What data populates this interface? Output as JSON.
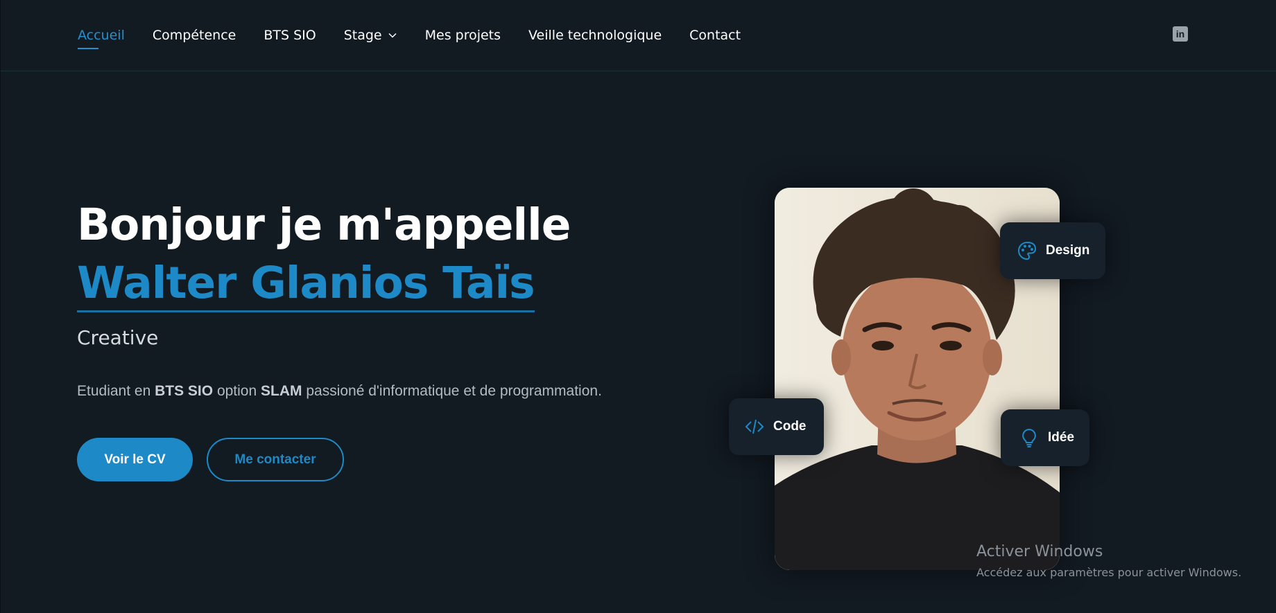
{
  "nav": {
    "items": [
      {
        "label": "Accueil",
        "active": true
      },
      {
        "label": "Compétence",
        "active": false
      },
      {
        "label": "BTS SIO",
        "active": false
      },
      {
        "label": "Stage",
        "active": false,
        "has_dropdown": true
      },
      {
        "label": "Mes projets",
        "active": false
      },
      {
        "label": "Veille technologique",
        "active": false
      },
      {
        "label": "Contact",
        "active": false
      }
    ],
    "social_icon": "linkedin-icon",
    "social_glyph": "in"
  },
  "hero": {
    "greeting": "Bonjour je m'appelle",
    "name": "Walter Glanios Taïs",
    "role": "Creative",
    "description": {
      "p1": "Etudiant en ",
      "b1": "BTS SIO",
      "p2": " option ",
      "b2": "SLAM",
      "p3": " passioné d'informatique et de programmation."
    },
    "cv_button": "Voir le CV",
    "contact_button": "Me contacter"
  },
  "chips": {
    "design": "Design",
    "code": "Code",
    "idee": "Idée"
  },
  "watermark": {
    "title": "Activer Windows",
    "subtitle": "Accédez aux paramètres pour activer Windows."
  },
  "colors": {
    "background": "#121a22",
    "accent": "#1d8ac7",
    "chip_background": "#16212b",
    "text": "#ffffff",
    "muted_text": "#b3bbc2"
  }
}
